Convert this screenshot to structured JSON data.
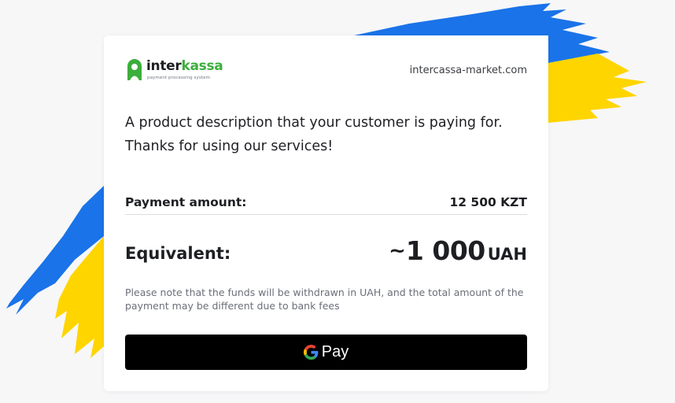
{
  "merchant": {
    "logo_word_a": "inter",
    "logo_word_b": "kassa",
    "logo_tagline": "payment processing system",
    "site": "intercassa-market.com",
    "brand_color": "#3cae3c"
  },
  "description": "A product description that your customer is paying for. Thanks for using our services!",
  "payment": {
    "amount_label": "Payment amount:",
    "amount_value": "12 500 KZT",
    "equivalent_label": "Equivalent:",
    "equivalent_prefix": "~",
    "equivalent_value": "1 000",
    "equivalent_currency": "UAH"
  },
  "note": "Please note that the funds will be withdrawn in UAH, and the total amount of the payment may be different due to bank fees",
  "gpay_button": {
    "label": "Pay",
    "icon": "google-g-icon",
    "background": "#000000"
  },
  "background_flag": {
    "colors": [
      "#1a73e8",
      "#ffd500"
    ]
  }
}
